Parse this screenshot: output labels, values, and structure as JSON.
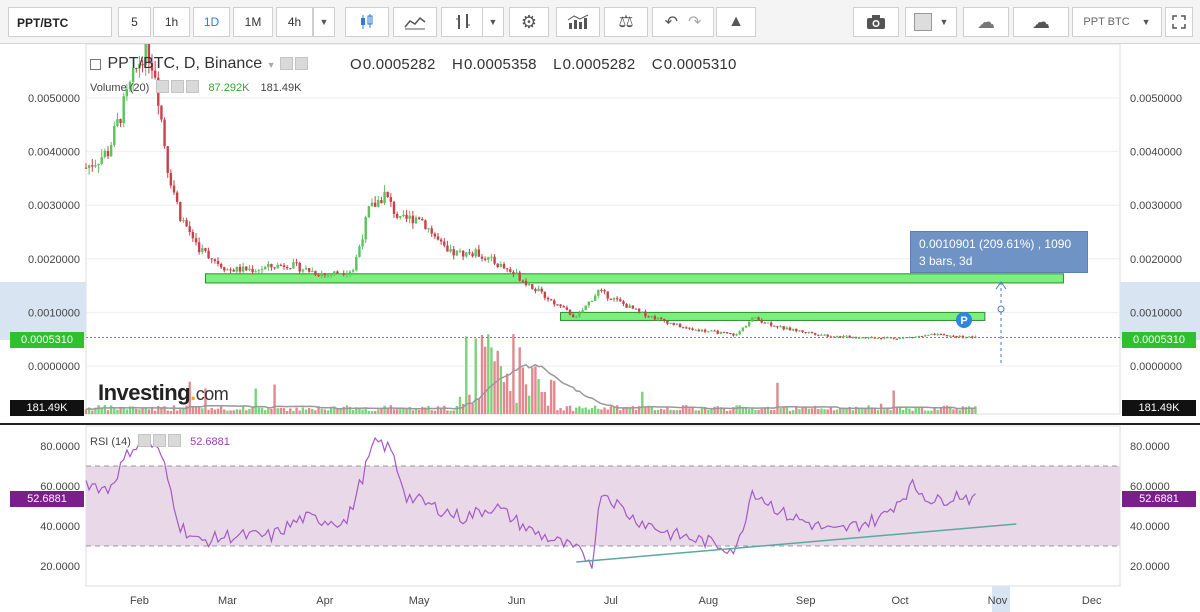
{
  "toolbar": {
    "symbol": "PPT/BTC",
    "intervals": [
      "5",
      "1h",
      "1D",
      "1M",
      "4h"
    ],
    "active_interval": "1D",
    "right_symbol": "PPT BTC"
  },
  "legend": {
    "title": "PPT/BTC, D, Binance",
    "o_label": "O",
    "o_value": "0.0005282",
    "h_label": "H",
    "h_value": "0.0005358",
    "l_label": "L",
    "l_value": "0.0005282",
    "c_label": "C",
    "c_value": "0.0005310"
  },
  "volume": {
    "label": "Volume (20)",
    "value1": "87.292K",
    "value2": "181.49K",
    "axis_tag": "181.49K"
  },
  "rsi": {
    "label": "RSI (14)",
    "value": "52.6881",
    "axis_tag": "52.6881"
  },
  "price_axis": {
    "ticks": [
      "0.0050000",
      "0.0040000",
      "0.0030000",
      "0.0020000",
      "0.0010000",
      "0.0000000"
    ],
    "current_tag": "0.0005310"
  },
  "rsi_axis": {
    "ticks": [
      "80.0000",
      "60.0000",
      "40.0000",
      "20.0000"
    ]
  },
  "time_axis": {
    "labels": [
      "Feb",
      "Mar",
      "Apr",
      "May",
      "Jun",
      "Jul",
      "Aug",
      "Sep",
      "Oct",
      "Nov",
      "Dec"
    ]
  },
  "measure": {
    "line1": "0.0010901 (209.61%) , 1090",
    "line2": "3 bars, 3d"
  },
  "marker": "P",
  "logo": {
    "main": "Investing",
    "dot": ".",
    "suffix": "com"
  },
  "colors": {
    "up": "#5cc25c",
    "down": "#c9404a",
    "zone": "#7cf07c",
    "rsi_line": "#a35ac4",
    "rsi_band": "#e6d6e6",
    "accent": "#2e7bd8",
    "current_price": "#2fc02f"
  },
  "chart_data": {
    "type": "candlestick",
    "x_range": [
      "2018-01-15",
      "2018-12-10"
    ],
    "price_ylim": [
      -0.0007,
      0.006
    ],
    "close_path": [
      [
        "2018-01-15",
        0.0037
      ],
      [
        "2018-01-22",
        0.004
      ],
      [
        "2018-01-29",
        0.0052
      ],
      [
        "2018-02-03",
        0.006
      ],
      [
        "2018-02-06",
        0.0055
      ],
      [
        "2018-02-10",
        0.0037
      ],
      [
        "2018-02-14",
        0.0028
      ],
      [
        "2018-02-20",
        0.0022
      ],
      [
        "2018-03-01",
        0.0018
      ],
      [
        "2018-03-10",
        0.0018
      ],
      [
        "2018-03-20",
        0.0019
      ],
      [
        "2018-04-01",
        0.0017
      ],
      [
        "2018-04-10",
        0.0018
      ],
      [
        "2018-04-15",
        0.0029
      ],
      [
        "2018-04-20",
        0.0032
      ],
      [
        "2018-04-25",
        0.0027
      ],
      [
        "2018-05-01",
        0.0028
      ],
      [
        "2018-05-10",
        0.0021
      ],
      [
        "2018-05-20",
        0.0021
      ],
      [
        "2018-06-01",
        0.0017
      ],
      [
        "2018-06-10",
        0.0013
      ],
      [
        "2018-06-20",
        0.0009
      ],
      [
        "2018-06-27",
        0.0014
      ],
      [
        "2018-07-10",
        0.001
      ],
      [
        "2018-07-25",
        0.0007
      ],
      [
        "2018-08-10",
        0.00058
      ],
      [
        "2018-08-15",
        0.0009
      ],
      [
        "2018-08-25",
        0.0007
      ],
      [
        "2018-09-10",
        0.00055
      ],
      [
        "2018-10-01",
        0.00052
      ],
      [
        "2018-10-12",
        0.00058
      ],
      [
        "2018-10-25",
        0.000531
      ]
    ],
    "zones": [
      {
        "from": "2018-02-22",
        "to": "2018-11-22",
        "low": 0.00155,
        "high": 0.00172
      },
      {
        "from": "2018-06-15",
        "to": "2018-10-28",
        "low": 0.00085,
        "high": 0.001
      }
    ],
    "rsi_ylim": [
      15,
      85
    ],
    "rsi_band": [
      30,
      70
    ],
    "rsi_path": [
      [
        "2018-01-15",
        62
      ],
      [
        "2018-01-22",
        58
      ],
      [
        "2018-01-29",
        78
      ],
      [
        "2018-02-03",
        84
      ],
      [
        "2018-02-08",
        75
      ],
      [
        "2018-02-14",
        40
      ],
      [
        "2018-02-20",
        32
      ],
      [
        "2018-03-01",
        35
      ],
      [
        "2018-03-15",
        35
      ],
      [
        "2018-03-25",
        44
      ],
      [
        "2018-04-08",
        42
      ],
      [
        "2018-04-12",
        60
      ],
      [
        "2018-04-17",
        83
      ],
      [
        "2018-04-22",
        78
      ],
      [
        "2018-04-27",
        55
      ],
      [
        "2018-05-05",
        50
      ],
      [
        "2018-05-15",
        44
      ],
      [
        "2018-05-25",
        50
      ],
      [
        "2018-06-05",
        38
      ],
      [
        "2018-06-20",
        28
      ],
      [
        "2018-06-25",
        22
      ],
      [
        "2018-06-28",
        58
      ],
      [
        "2018-07-08",
        44
      ],
      [
        "2018-07-20",
        36
      ],
      [
        "2018-08-01",
        32
      ],
      [
        "2018-08-10",
        28
      ],
      [
        "2018-08-15",
        58
      ],
      [
        "2018-08-25",
        46
      ],
      [
        "2018-09-10",
        37
      ],
      [
        "2018-09-25",
        44
      ],
      [
        "2018-10-05",
        60
      ],
      [
        "2018-10-12",
        52
      ],
      [
        "2018-10-20",
        56
      ],
      [
        "2018-10-25",
        52.6881
      ]
    ],
    "rsi_trendline": [
      [
        "2018-06-20",
        22
      ],
      [
        "2018-11-07",
        41
      ]
    ]
  }
}
